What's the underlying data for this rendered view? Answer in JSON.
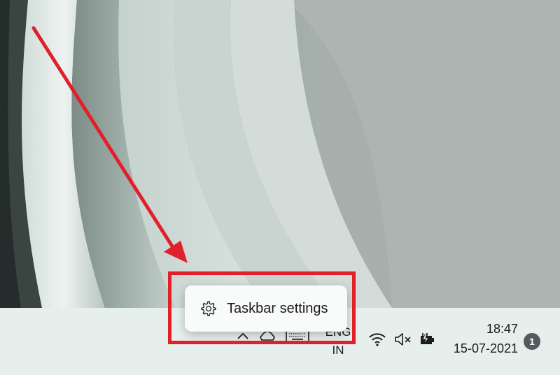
{
  "context_menu": {
    "item_label": "Taskbar settings",
    "item_icon": "gear-icon"
  },
  "tray": {
    "overflow_icon": "chevron-up-icon",
    "cloud_icon": "onedrive-icon",
    "keyboard_icon": "touch-keyboard-icon",
    "language_primary": "ENG",
    "language_secondary": "IN",
    "wifi_icon": "wifi-icon",
    "volume_icon": "volume-muted-icon",
    "battery_icon": "battery-charging-icon"
  },
  "clock": {
    "time": "18:47",
    "date": "15-07-2021"
  },
  "notifications": {
    "count": "1"
  },
  "annotation": {
    "highlight_color": "#e0202a",
    "arrow_color": "#e0202a"
  }
}
